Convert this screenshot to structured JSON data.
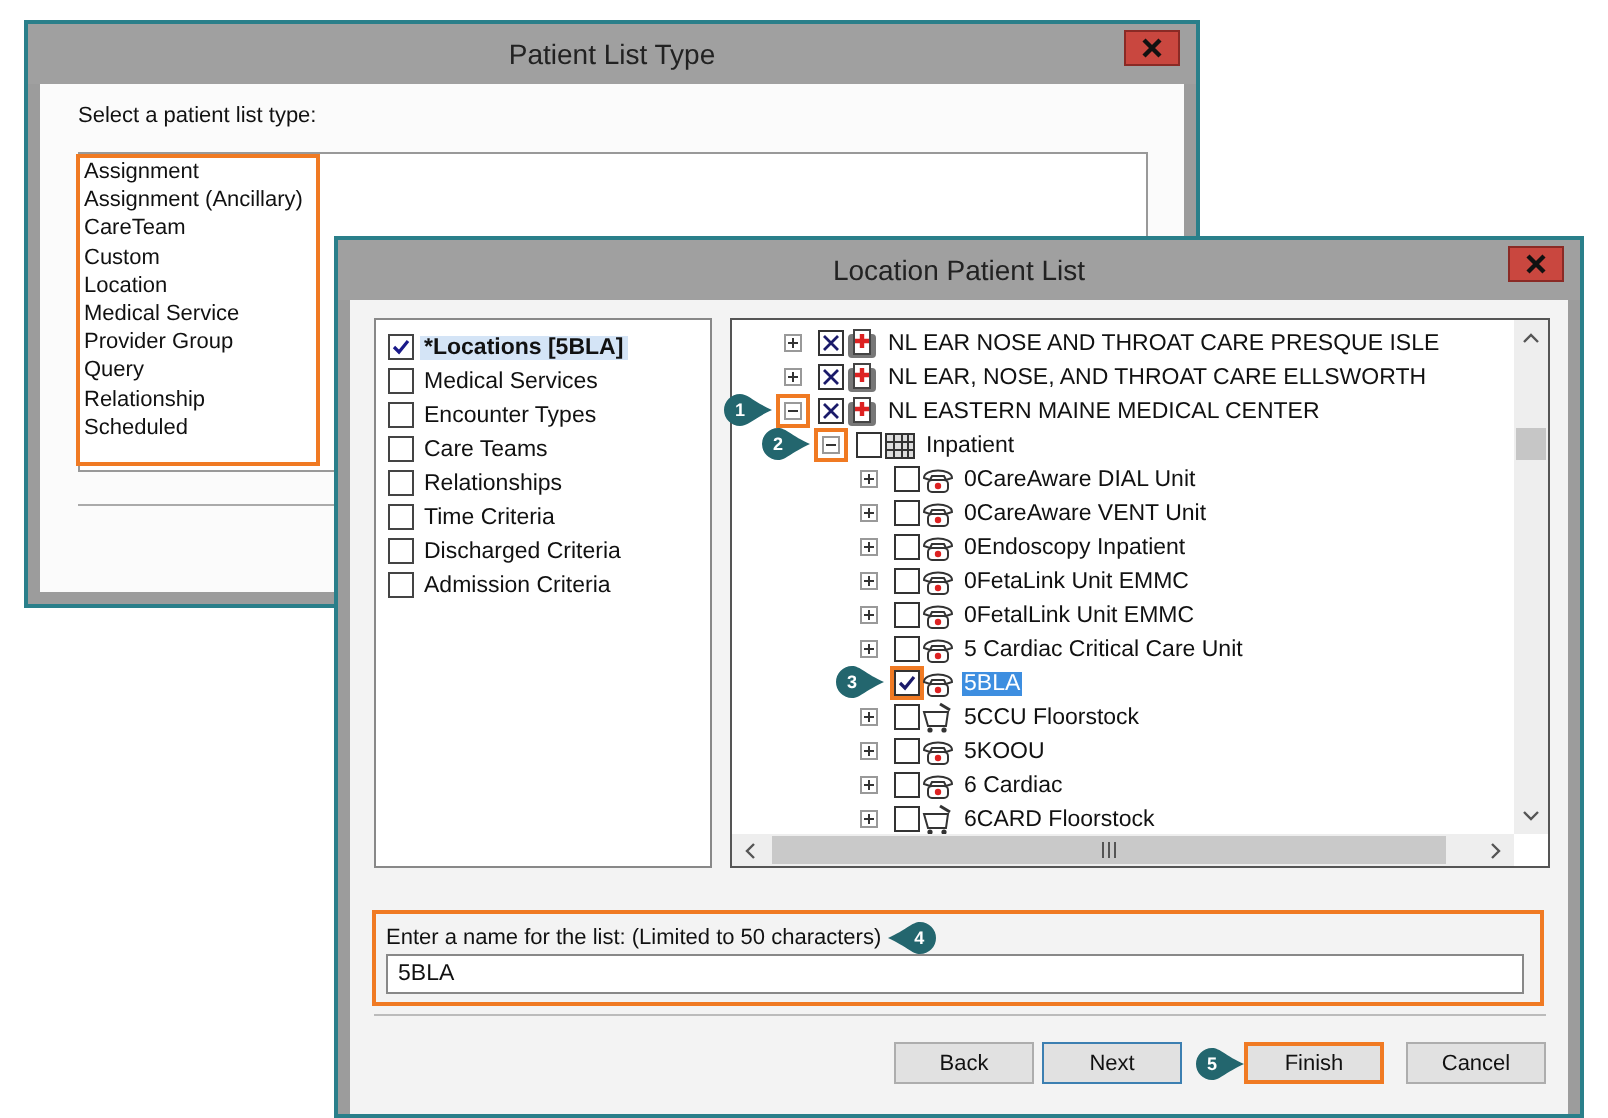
{
  "type_dialog": {
    "title": "Patient List Type",
    "prompt": "Select a patient list type:",
    "highlighted": true,
    "types": [
      "Assignment",
      "Assignment (Ancillary)",
      "CareTeam",
      "Custom",
      "Location",
      "Medical Service",
      "Provider Group",
      "Query",
      "Relationship",
      "Scheduled"
    ]
  },
  "location_dialog": {
    "title": "Location Patient List",
    "criteria": [
      {
        "label": "*Locations [5BLA]",
        "checked": true,
        "selected": true
      },
      {
        "label": "Medical Services",
        "checked": false,
        "selected": false
      },
      {
        "label": "Encounter Types",
        "checked": false,
        "selected": false
      },
      {
        "label": "Care Teams",
        "checked": false,
        "selected": false
      },
      {
        "label": "Relationships",
        "checked": false,
        "selected": false
      },
      {
        "label": "Time Criteria",
        "checked": false,
        "selected": false
      },
      {
        "label": "Discharged Criteria",
        "checked": false,
        "selected": false
      },
      {
        "label": "Admission Criteria",
        "checked": false,
        "selected": false
      }
    ],
    "tree": [
      {
        "label": "NL EAR NOSE AND THROAT CARE PRESQUE ISLE",
        "kind": "hospital",
        "excluded": true,
        "expanded": false,
        "selected": false
      },
      {
        "label": "NL EAR, NOSE, AND THROAT CARE ELLSWORTH",
        "kind": "hospital",
        "excluded": true,
        "expanded": false,
        "selected": false
      },
      {
        "label": "NL EASTERN MAINE MEDICAL CENTER",
        "kind": "hospital",
        "excluded": true,
        "expanded": true,
        "selected": false,
        "callout": "1",
        "expander_highlighted": true,
        "children": [
          {
            "label": "Inpatient",
            "kind": "grid",
            "checked": false,
            "expanded": true,
            "selected": false,
            "callout": "2",
            "expander_highlighted": true,
            "children": [
              {
                "label": "0CareAware DIAL Unit",
                "kind": "unit",
                "checked": false,
                "expanded": false,
                "selected": false
              },
              {
                "label": "0CareAware VENT Unit",
                "kind": "unit",
                "checked": false,
                "expanded": false,
                "selected": false
              },
              {
                "label": "0Endoscopy Inpatient",
                "kind": "unit",
                "checked": false,
                "expanded": false,
                "selected": false
              },
              {
                "label": "0FetaLink Unit EMMC",
                "kind": "unit",
                "checked": false,
                "expanded": false,
                "selected": false
              },
              {
                "label": "0FetalLink Unit EMMC",
                "kind": "unit",
                "checked": false,
                "expanded": false,
                "selected": false
              },
              {
                "label": "5 Cardiac Critical Care Unit",
                "kind": "unit",
                "checked": false,
                "expanded": false,
                "selected": false
              },
              {
                "label": "5BLA",
                "kind": "unit",
                "checked": true,
                "selected": true,
                "callout": "3",
                "checkbox_highlighted": true
              },
              {
                "label": "5CCU Floorstock",
                "kind": "cart",
                "checked": false,
                "expanded": false,
                "selected": false
              },
              {
                "label": "5KOOU",
                "kind": "unit",
                "checked": false,
                "expanded": false,
                "selected": false
              },
              {
                "label": "6 Cardiac",
                "kind": "unit",
                "checked": false,
                "expanded": false,
                "selected": false
              },
              {
                "label": "6CARD Floorstock",
                "kind": "cart",
                "checked": false,
                "expanded": false,
                "selected": false
              }
            ]
          }
        ]
      }
    ],
    "name_field": {
      "label": "Enter a name for the list: (Limited to 50 characters)",
      "value": "5BLA",
      "highlighted": true,
      "callout": "4"
    },
    "buttons": [
      {
        "label": "Back",
        "default": false,
        "highlighted": false
      },
      {
        "label": "Next",
        "default": true,
        "highlighted": false
      },
      {
        "label": "Finish",
        "default": false,
        "highlighted": true,
        "callout": "5"
      },
      {
        "label": "Cancel",
        "default": false,
        "highlighted": false
      }
    ]
  }
}
